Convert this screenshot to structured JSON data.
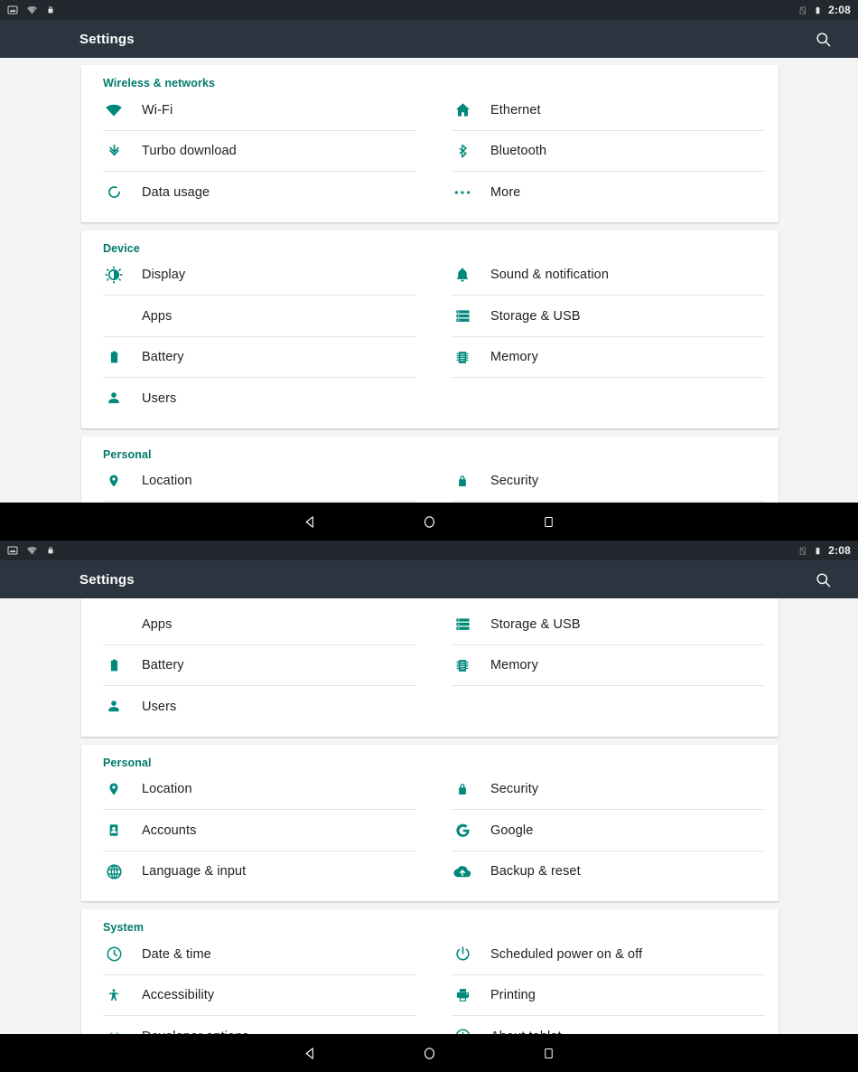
{
  "status_bar": {
    "icons_left": [
      "screenshot-icon",
      "wifi-no-internet-icon",
      "lock-icon"
    ],
    "icons_right": [
      "no-sim-icon",
      "battery-icon"
    ],
    "time": "2:08"
  },
  "toolbar": {
    "title": "Settings",
    "search_icon": "search-icon"
  },
  "nav_bar": {
    "back": "back-triangle-icon",
    "home": "home-circle-icon",
    "recents": "recents-square-icon"
  },
  "colors": {
    "accent_teal": "#00897b",
    "header_teal": "#00796b",
    "toolbar_bg": "#2b3540",
    "status_bg": "#22282d",
    "page_bg": "#f4f4f4",
    "card_bg": "#ffffff",
    "divider": "#e4e6e6",
    "label": "#212121",
    "navbar_bg": "#000000"
  },
  "screen_1": {
    "sections": [
      {
        "title": "Wireless & networks",
        "rows": [
          [
            {
              "label": "Wi-Fi",
              "icon": "wifi-icon"
            },
            {
              "label": "Ethernet",
              "icon": "ethernet-home-icon"
            }
          ],
          [
            {
              "label": "Turbo download",
              "icon": "turbo-download-icon"
            },
            {
              "label": "Bluetooth",
              "icon": "bluetooth-icon"
            }
          ],
          [
            {
              "label": "Data usage",
              "icon": "data-usage-icon"
            },
            {
              "label": "More",
              "icon": "more-ellipsis-icon"
            }
          ]
        ]
      },
      {
        "title": "Device",
        "rows": [
          [
            {
              "label": "Display",
              "icon": "display-brightness-icon"
            },
            {
              "label": "Sound & notification",
              "icon": "bell-icon"
            }
          ],
          [
            {
              "label": "Apps",
              "icon": "android-apps-icon"
            },
            {
              "label": "Storage & USB",
              "icon": "storage-icon"
            }
          ],
          [
            {
              "label": "Battery",
              "icon": "battery-icon"
            },
            {
              "label": "Memory",
              "icon": "memory-chip-icon"
            }
          ],
          [
            {
              "label": "Users",
              "icon": "user-person-icon"
            },
            {
              "label": "",
              "icon": ""
            }
          ]
        ]
      },
      {
        "title": "Personal",
        "rows": [
          [
            {
              "label": "Location",
              "icon": "location-pin-icon"
            },
            {
              "label": "Security",
              "icon": "lock-security-icon"
            }
          ],
          [
            {
              "label": "Accounts",
              "icon": "accounts-card-icon"
            },
            {
              "label": "Google",
              "icon": "google-g-icon"
            }
          ]
        ]
      }
    ]
  },
  "screen_2": {
    "sections": [
      {
        "title": "",
        "rows": [
          [
            {
              "label": "Apps",
              "icon": "android-apps-icon"
            },
            {
              "label": "Storage & USB",
              "icon": "storage-icon"
            }
          ],
          [
            {
              "label": "Battery",
              "icon": "battery-icon"
            },
            {
              "label": "Memory",
              "icon": "memory-chip-icon"
            }
          ],
          [
            {
              "label": "Users",
              "icon": "user-person-icon"
            },
            {
              "label": "",
              "icon": ""
            }
          ]
        ]
      },
      {
        "title": "Personal",
        "rows": [
          [
            {
              "label": "Location",
              "icon": "location-pin-icon"
            },
            {
              "label": "Security",
              "icon": "lock-security-icon"
            }
          ],
          [
            {
              "label": "Accounts",
              "icon": "accounts-card-icon"
            },
            {
              "label": "Google",
              "icon": "google-g-icon"
            }
          ],
          [
            {
              "label": "Language & input",
              "icon": "globe-icon"
            },
            {
              "label": "Backup & reset",
              "icon": "backup-cloud-icon"
            }
          ]
        ]
      },
      {
        "title": "System",
        "rows": [
          [
            {
              "label": "Date & time",
              "icon": "clock-icon"
            },
            {
              "label": "Scheduled power on & off",
              "icon": "power-icon"
            }
          ],
          [
            {
              "label": "Accessibility",
              "icon": "accessibility-icon"
            },
            {
              "label": "Printing",
              "icon": "printer-icon"
            }
          ],
          [
            {
              "label": "Developer options",
              "icon": "developer-braces-icon"
            },
            {
              "label": "About tablet",
              "icon": "info-icon"
            }
          ]
        ]
      }
    ]
  }
}
